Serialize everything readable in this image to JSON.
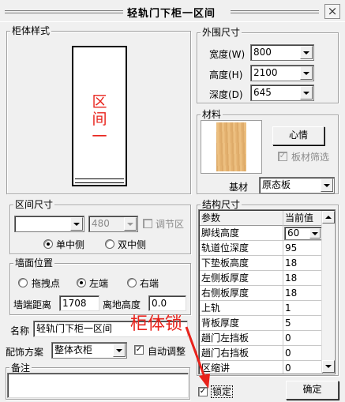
{
  "window": {
    "title": "轻轨门下柜一区间",
    "close_glyph": "×"
  },
  "cabinet_style": {
    "label": "柜体样式",
    "preview_text": [
      "区",
      "间",
      "一"
    ]
  },
  "outer_size": {
    "label": "外围尺寸",
    "width_label": "宽度(W)",
    "width_value": "800",
    "height_label": "高度(H)",
    "height_value": "2100",
    "depth_label": "深度(D)",
    "depth_value": "645"
  },
  "material": {
    "label": "材料",
    "feel_button": "心情",
    "board_filter_label": "板材筛选",
    "base_label": "基材",
    "base_value": "原态板"
  },
  "interval_size": {
    "label": "区间尺寸",
    "first_select": "",
    "second_select": "480",
    "adjust_label": "调节区",
    "radio_single": "单中侧",
    "radio_double": "双中侧"
  },
  "wall_position": {
    "label": "墙面位置",
    "radio_drag": "拖拽点",
    "radio_left": "左端",
    "radio_right": "右端",
    "wall_distance_label": "墙端距离",
    "wall_distance_value": "1708",
    "floor_height_label": "离地高度",
    "floor_height_value": "0.0"
  },
  "name_row": {
    "label": "名称",
    "value": "轻轨门下柜一区间"
  },
  "decor_row": {
    "label": "配饰方案",
    "value": "整体衣柜",
    "auto_adjust_label": "自动调整"
  },
  "remark": {
    "label": "备注",
    "value": ""
  },
  "structure": {
    "label": "结构尺寸",
    "headers": [
      "参数",
      "当前值"
    ],
    "rows": [
      [
        "脚线高度",
        "60"
      ],
      [
        "轨道位深度",
        "95"
      ],
      [
        "下垫板高度",
        "18"
      ],
      [
        "左侧板厚度",
        "18"
      ],
      [
        "右侧板厚度",
        "18"
      ],
      [
        "上轨",
        "1"
      ],
      [
        "背板厚度",
        "5"
      ],
      [
        "趟门左挡板",
        "0"
      ],
      [
        "趟门右挡板",
        "0"
      ],
      [
        "区缩讲",
        "0"
      ]
    ]
  },
  "lock": {
    "label": "锁定"
  },
  "confirm_button": "确定",
  "annotation": {
    "text": "柜体锁",
    "color": "#e8231c"
  },
  "colors": {
    "accent_red": "#e8231c",
    "wood": "#e9b877"
  }
}
